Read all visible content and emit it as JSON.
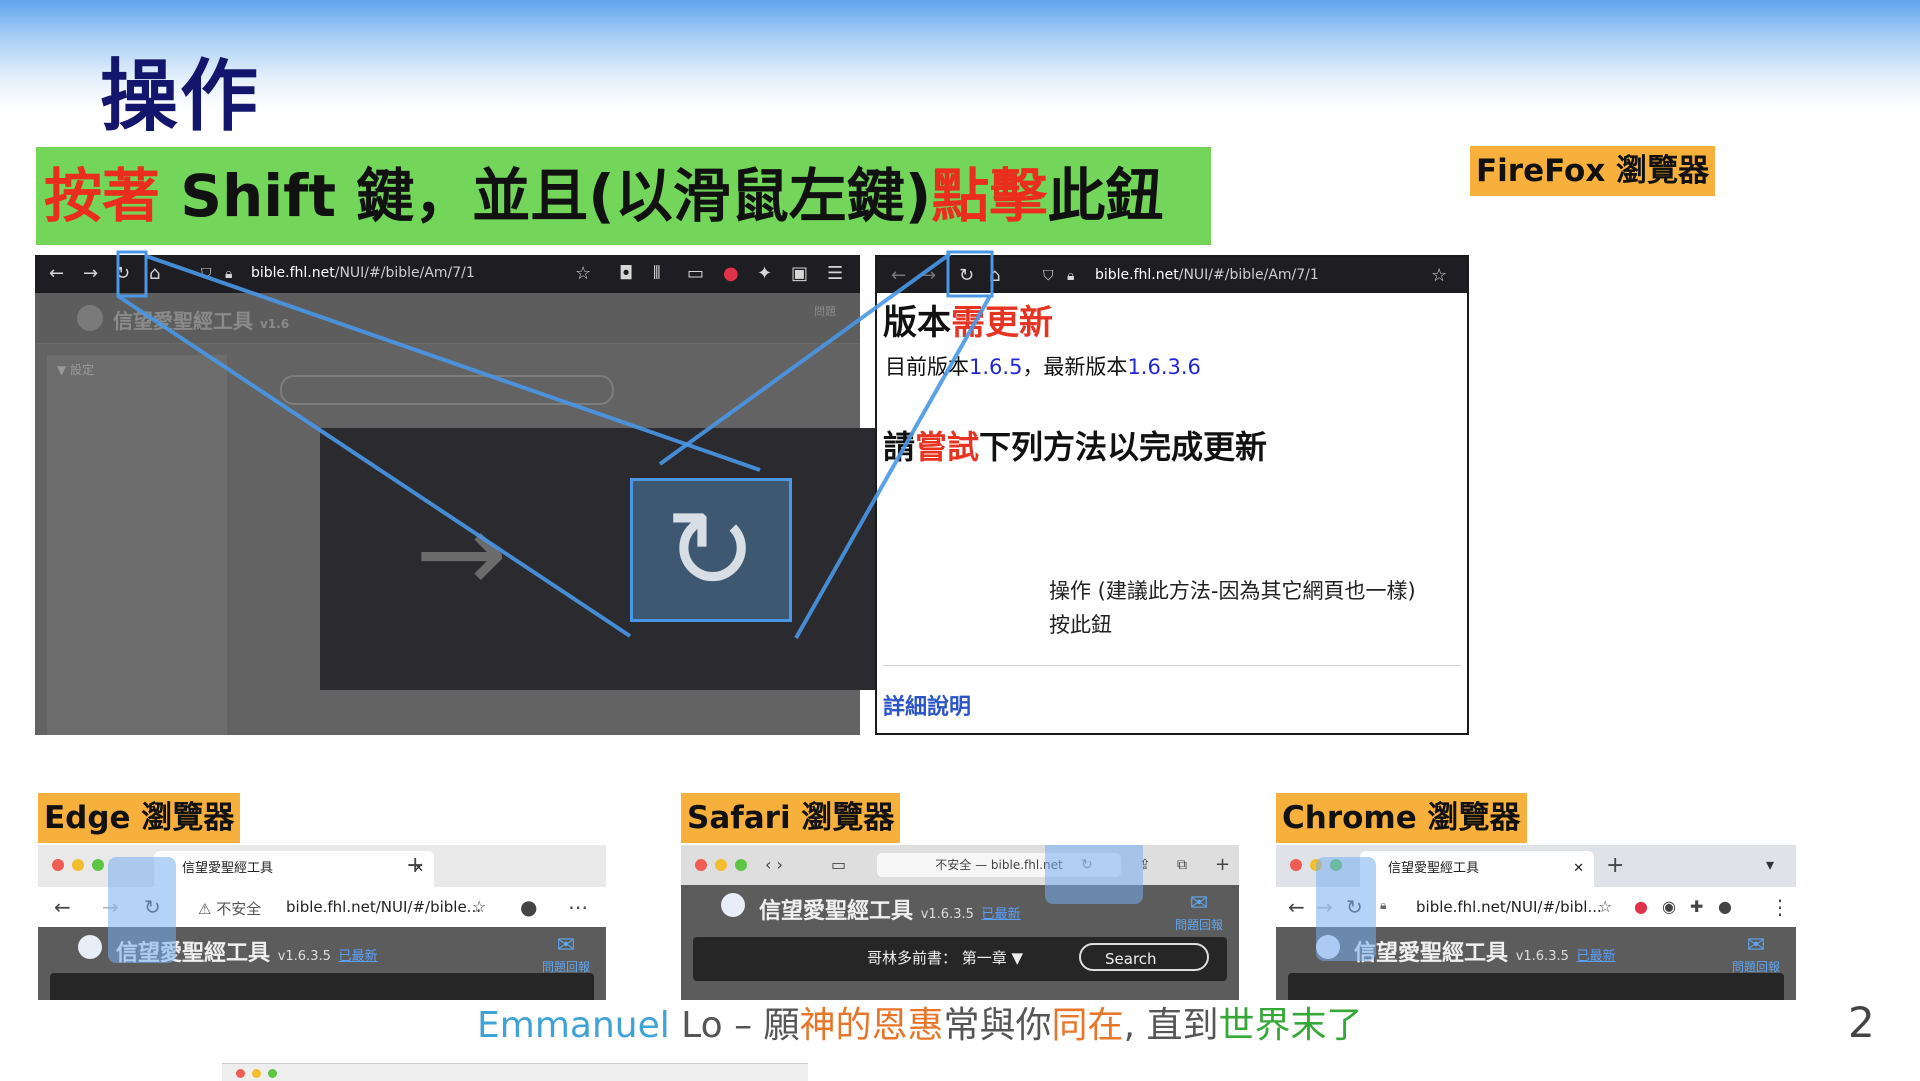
{
  "slide": {
    "title": "操作",
    "instruction": {
      "part1": "按著",
      "part2": " Shift 鍵，並且(以滑鼠左鍵)",
      "part3": "點擊",
      "part4": "此鈕"
    },
    "page_number": "2"
  },
  "labels": {
    "firefox": "FireFox 瀏覽器",
    "edge": "Edge 瀏覽器",
    "safari": "Safari 瀏覽器",
    "chrome": "Chrome 瀏覽器"
  },
  "firefox_left": {
    "url_domain": "bible.fhl.net",
    "url_path": "/NUI/#/bible/Am/7/1",
    "app_title": "信望愛聖經工具",
    "app_version": "v1.6",
    "help_label": "問題",
    "sidebar_label": "▼ 設定"
  },
  "firefox_right": {
    "url_domain": "bible.fhl.net",
    "url_path": "/NUI/#/bible/Am/7/1",
    "heading_a": "版本",
    "heading_b": "需更新",
    "current_label": "目前版本",
    "current_version": "1.6.5",
    "latest_label": "，最新版本",
    "latest_version": "1.6.3.6",
    "method_a": "請",
    "method_b": "嘗試",
    "method_c": "下列方法以完成更新",
    "line1": "操作 (建議此方法-因為其它網頁也一樣)",
    "line2": "按此鈕",
    "details_link": "詳細說明"
  },
  "edge": {
    "tab_title": "信望愛聖經工具",
    "insecure": "不安全",
    "url": "bible.fhl.net/NUI/#/bible...",
    "app_title": "信望愛聖經工具",
    "version": "v1.6.3.5",
    "update": "已最新",
    "help": "問題回報"
  },
  "safari": {
    "addr": "不安全 — bible.fhl.net",
    "app_title": "信望愛聖經工具",
    "version": "v1.6.3.5",
    "update": "已最新",
    "help": "問題回報",
    "book": "哥林多前書： 第一章 ▼",
    "search": "Search"
  },
  "chrome": {
    "tab_title": "信望愛聖經工具",
    "url": "bible.fhl.net/NUI/#/bibl...",
    "app_title": "信望愛聖經工具",
    "version": "v1.6.3.5",
    "update": "已最新",
    "help": "問題回報"
  },
  "footer": {
    "name_a": "Emmanuel",
    "name_b": " Lo – 願",
    "grace": "神的恩惠",
    "common": "常與你",
    "together": "同在",
    "until": ", 直到",
    "end": "世界末了"
  },
  "colors": {
    "title": "#14166e",
    "instruction_bg": "#73d55a",
    "instruction_red": "#ea2d1c",
    "label_bg": "#f7b03c",
    "callout_blue": "#4a97e6"
  }
}
